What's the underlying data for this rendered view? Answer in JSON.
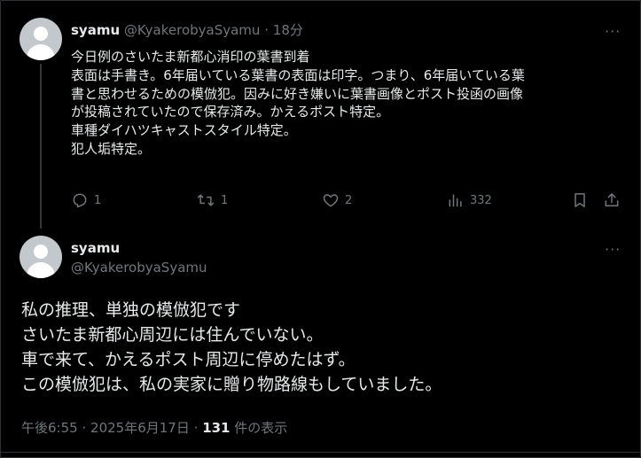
{
  "reply_post": {
    "author_name": "syamu",
    "author_handle": "@KyakerobyaSyamu",
    "separator": "·",
    "time_ago": "18分",
    "more_label": "···",
    "lines": [
      "今日例のさいたま新都心消印の葉書到着",
      "表面は手書き。6年届いている葉書の表面は印字。つまり、6年届いている葉",
      "書と思わせるための模倣犯。因みに好き嫌いに葉書画像とポスト投函の画像",
      "が投稿されていたので保存済み。かえるポスト特定。",
      "車種ダイハツキャストスタイル特定。",
      "犯人垢特定。"
    ],
    "actions": {
      "reply_count": "1",
      "repost_count": "1",
      "like_count": "2",
      "views_count": "332"
    },
    "icons": [
      "reply-icon",
      "repost-icon",
      "like-icon",
      "views-icon",
      "bookmark-icon",
      "share-icon"
    ]
  },
  "main_post": {
    "author_name": "syamu",
    "author_handle": "@KyakerobyaSyamu",
    "more_label": "···",
    "lines": [
      "私の推理、単独の模倣犯です",
      "さいたま新都心周辺には住んでいない。",
      "車で来て、かえるポスト周辺に停めたはず。",
      "この模倣犯は、私の実家に贈り物路線もしていました。"
    ],
    "footer": {
      "time": "午後6:55",
      "separator": "·",
      "date": "2025年6月17日",
      "views_count": "131",
      "views_label": "件の表示"
    }
  },
  "colors": {
    "background": "#000000",
    "text": "#e7e9ea",
    "muted": "#71767b",
    "divider": "#2f3336",
    "avatar": "#c3c8cc"
  }
}
